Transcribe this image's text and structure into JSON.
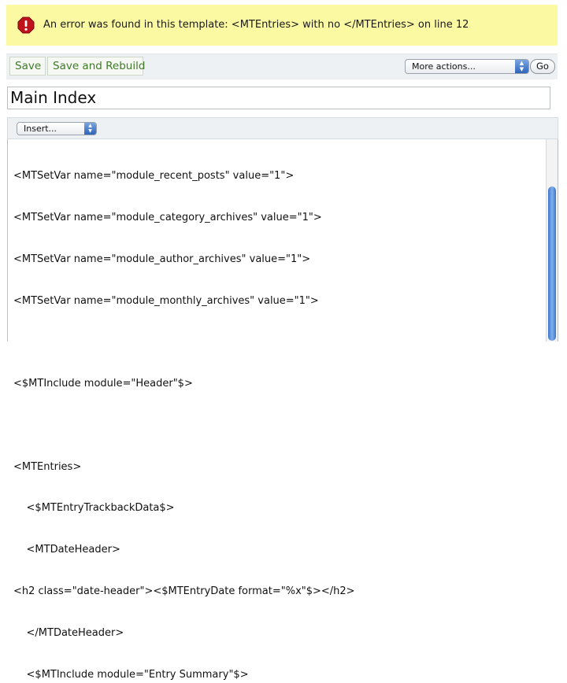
{
  "error": {
    "icon": "error-stop-icon",
    "message": "An error was found in this template: <MTEntries> with no </MTEntries> on line 12",
    "background": "#fbf9a2",
    "icon_color": "#c0121b"
  },
  "toolbar": {
    "save_label": "Save",
    "save_rebuild_label": "Save and Rebuild",
    "actions_select_value": "More actions...",
    "go_label": "Go"
  },
  "template": {
    "name": "Main Index"
  },
  "editor_toolbar": {
    "insert_select_value": "Insert..."
  },
  "code": {
    "lines": [
      "<MTSetVar name=\"module_recent_posts\" value=\"1\">",
      "<MTSetVar name=\"module_category_archives\" value=\"1\">",
      "<MTSetVar name=\"module_author_archives\" value=\"1\">",
      "<MTSetVar name=\"module_monthly_archives\" value=\"1\">",
      "",
      "<$MTInclude module=\"Header\"$>",
      "",
      "<MTEntries>",
      "    <$MTEntryTrackbackData$>",
      "    <MTDateHeader>",
      "<h2 class=\"date-header\"><$MTEntryDate format=\"%x\"$></h2>",
      "    </MTDateHeader>",
      "    <$MTInclude module=\"Entry Summary\"$>"
    ]
  }
}
